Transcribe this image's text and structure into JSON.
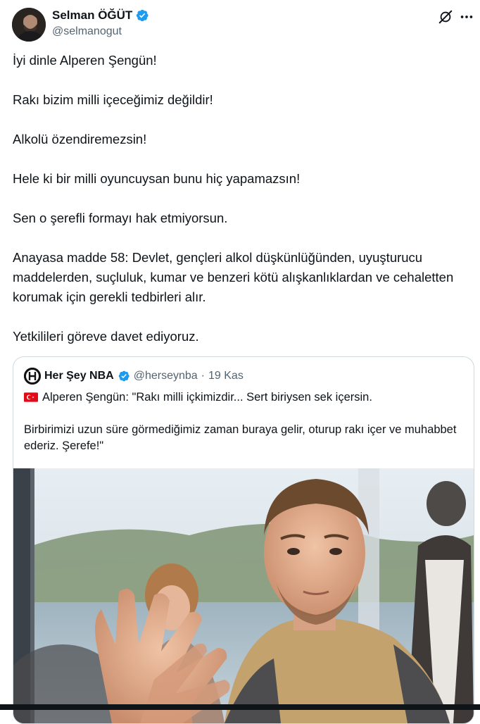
{
  "author": {
    "name": "Selman ÖĞÜT",
    "handle": "@selmanogut",
    "verified_color": "#1d9bf0"
  },
  "icons": {
    "grok": "grok-icon",
    "more": "more-icon"
  },
  "tweet": {
    "paragraphs": [
      "İyi dinle Alperen Şengün!",
      "Rakı bizim milli içeceğimiz değildir!",
      "Alkolü özendiremezsin!",
      "Hele ki bir milli oyuncuysan bunu hiç yapamazsın!",
      "Sen o şerefli formayı hak etmiyorsun.",
      "Anayasa madde 58: Devlet, gençleri alkol düşkünlüğünden, uyuşturucu maddelerden, suçluluk, kumar ve benzeri kötü alışkanlıklardan ve cehaletten korumak için gerekli tedbirleri alır.",
      "Yetkilileri göreve davet ediyoruz."
    ]
  },
  "quote": {
    "name": "Her Şey NBA",
    "handle": "@herseynba",
    "separator": "·",
    "date": "19 Kas",
    "line1": "Alperen Şengün: \"Rakı milli içkimizdir... Sert biriysen sek içersin.",
    "line2": "Birbirimizi uzun süre görmediğimiz zaman buraya gelir, oturup rakı içer ve muhabbet ederiz. Şerefe!\"",
    "flag_emoji": "turkey-flag"
  }
}
